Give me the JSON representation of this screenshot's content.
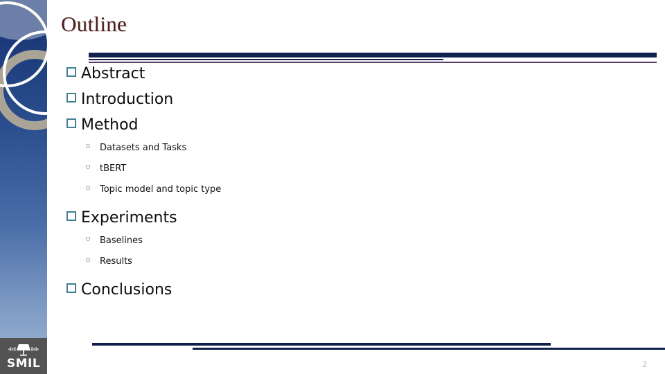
{
  "slide": {
    "title": "Outline",
    "page_number": "2",
    "theme": {
      "title_color": "#4a1f1c",
      "rule_navy": "#10204f",
      "rule_purple": "#5d3b63",
      "bullet_square_color": "#3f7f91",
      "bullet_circle_color": "#8fa8bd",
      "sidebar_top": "#16306b",
      "sidebar_bottom": "#9fb6d4",
      "sidebar_square": "#6b7fa8",
      "sidebar_ring_white": "#fdfdf6",
      "sidebar_ring_tan": "#a9a496",
      "logo_box": "#535353",
      "page_number_color": "#b6b6a8"
    }
  },
  "branding": {
    "logo_text": "SMIL",
    "logo_icon": "lamp-icon"
  },
  "outline": {
    "items": [
      {
        "level": 1,
        "label": "Abstract"
      },
      {
        "level": 1,
        "label": "Introduction"
      },
      {
        "level": 1,
        "label": "Method"
      },
      {
        "level": 2,
        "label": "Datasets and Tasks"
      },
      {
        "level": 2,
        "label": "tBERT"
      },
      {
        "level": 2,
        "label": "Topic model and topic type"
      },
      {
        "level": 1,
        "label": "Experiments"
      },
      {
        "level": 2,
        "label": "Baselines"
      },
      {
        "level": 2,
        "label": "Results"
      },
      {
        "level": 1,
        "label": "Conclusions"
      }
    ]
  }
}
